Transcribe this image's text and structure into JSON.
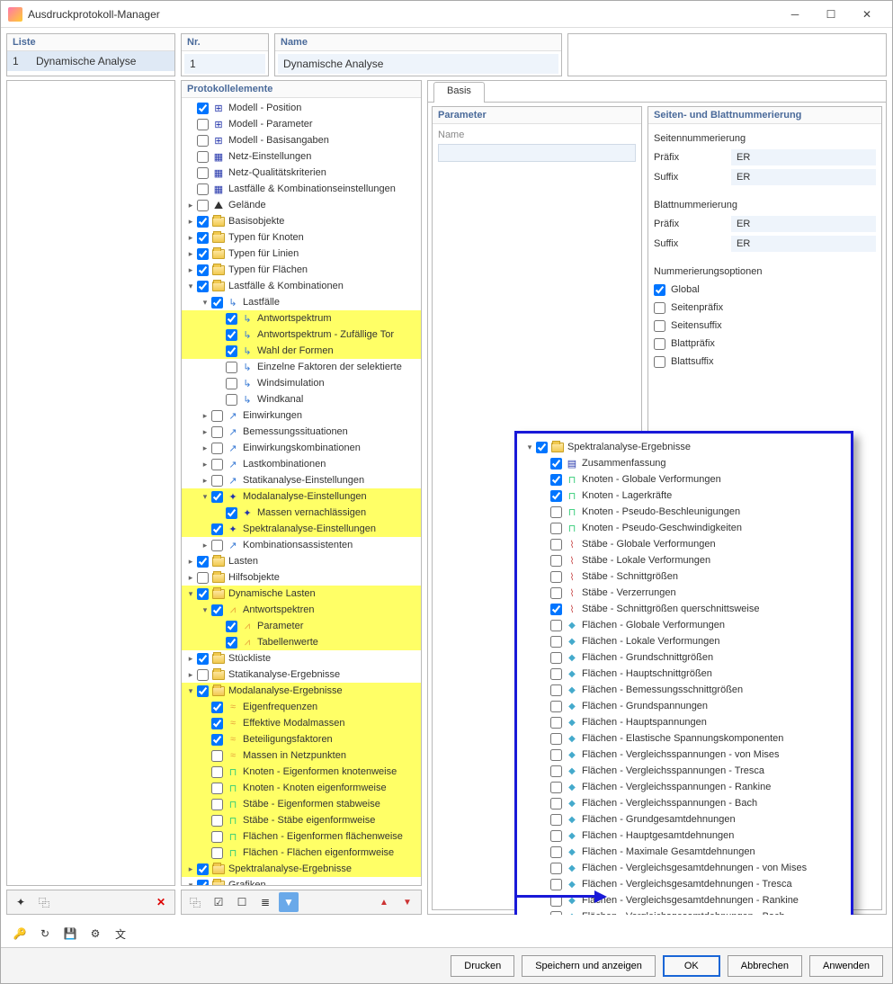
{
  "window": {
    "title": "Ausdruckprotokoll-Manager"
  },
  "liste": {
    "header": "Liste",
    "num": "1",
    "name": "Dynamische Analyse"
  },
  "nr": {
    "header": "Nr.",
    "value": "1"
  },
  "name": {
    "header": "Name",
    "value": "Dynamische Analyse"
  },
  "proto": {
    "header": "Protokollelemente"
  },
  "tree": [
    {
      "d": 0,
      "c": null,
      "k": true,
      "i": "mod",
      "t": "Modell - Position"
    },
    {
      "d": 0,
      "c": null,
      "k": false,
      "i": "mod",
      "t": "Modell - Parameter"
    },
    {
      "d": 0,
      "c": null,
      "k": false,
      "i": "mod",
      "t": "Modell - Basisangaben"
    },
    {
      "d": 0,
      "c": null,
      "k": false,
      "i": "grid",
      "t": "Netz-Einstellungen"
    },
    {
      "d": 0,
      "c": null,
      "k": false,
      "i": "grid",
      "t": "Netz-Qualitätskriterien"
    },
    {
      "d": 0,
      "c": null,
      "k": false,
      "i": "grid",
      "t": "Lastfälle & Kombinationseinstellungen"
    },
    {
      "d": 0,
      "c": "r",
      "k": false,
      "i": "ter",
      "t": "Gelände"
    },
    {
      "d": 0,
      "c": "r",
      "k": true,
      "i": "fld",
      "t": "Basisobjekte"
    },
    {
      "d": 0,
      "c": "r",
      "k": true,
      "i": "fld",
      "t": "Typen für Knoten"
    },
    {
      "d": 0,
      "c": "r",
      "k": true,
      "i": "fld",
      "t": "Typen für Linien"
    },
    {
      "d": 0,
      "c": "r",
      "k": true,
      "i": "fld",
      "t": "Typen für Flächen"
    },
    {
      "d": 0,
      "c": "d",
      "k": true,
      "i": "fld",
      "t": "Lastfälle & Kombinationen"
    },
    {
      "d": 1,
      "c": "d",
      "k": true,
      "i": "blue",
      "t": "Lastfälle"
    },
    {
      "d": 2,
      "c": null,
      "k": true,
      "i": "blue",
      "t": "Antwortspektrum",
      "hl": true
    },
    {
      "d": 2,
      "c": null,
      "k": true,
      "i": "blue",
      "t": "Antwortspektrum - Zufällige Tor",
      "hl": true
    },
    {
      "d": 2,
      "c": null,
      "k": true,
      "i": "blue",
      "t": "Wahl der Formen",
      "hl": true
    },
    {
      "d": 2,
      "c": null,
      "k": false,
      "i": "blue",
      "t": "Einzelne Faktoren der selektierte"
    },
    {
      "d": 2,
      "c": null,
      "k": false,
      "i": "blue",
      "t": "Windsimulation"
    },
    {
      "d": 2,
      "c": null,
      "k": false,
      "i": "blue",
      "t": "Windkanal"
    },
    {
      "d": 1,
      "c": "r",
      "k": false,
      "i": "arr",
      "t": "Einwirkungen"
    },
    {
      "d": 1,
      "c": "r",
      "k": false,
      "i": "arr",
      "t": "Bemessungssituationen"
    },
    {
      "d": 1,
      "c": "r",
      "k": false,
      "i": "arr",
      "t": "Einwirkungskombinationen"
    },
    {
      "d": 1,
      "c": "r",
      "k": false,
      "i": "arr",
      "t": "Lastkombinationen"
    },
    {
      "d": 1,
      "c": "r",
      "k": false,
      "i": "arr",
      "t": "Statikanalyse-Einstellungen"
    },
    {
      "d": 1,
      "c": "d",
      "k": true,
      "i": "mod2",
      "t": "Modalanalyse-Einstellungen",
      "hl": true
    },
    {
      "d": 2,
      "c": null,
      "k": true,
      "i": "mod2",
      "t": "Massen vernachlässigen",
      "hl": true
    },
    {
      "d": 1,
      "c": null,
      "k": true,
      "i": "mod2",
      "t": "Spektralanalyse-Einstellungen",
      "hl": true
    },
    {
      "d": 1,
      "c": "r",
      "k": false,
      "i": "arr",
      "t": "Kombinationsassistenten"
    },
    {
      "d": 0,
      "c": "r",
      "k": true,
      "i": "fld",
      "t": "Lasten"
    },
    {
      "d": 0,
      "c": "r",
      "k": false,
      "i": "fld",
      "t": "Hilfsobjekte"
    },
    {
      "d": 0,
      "c": "d",
      "k": true,
      "i": "fld",
      "t": "Dynamische Lasten",
      "hl": true
    },
    {
      "d": 1,
      "c": "d",
      "k": true,
      "i": "spec",
      "t": "Antwortspektren",
      "hl": true
    },
    {
      "d": 2,
      "c": null,
      "k": true,
      "i": "spec",
      "t": "Parameter",
      "hl": true
    },
    {
      "d": 2,
      "c": null,
      "k": true,
      "i": "spec",
      "t": "Tabellenwerte",
      "hl": true
    },
    {
      "d": 0,
      "c": "r",
      "k": true,
      "i": "fld",
      "t": "Stückliste"
    },
    {
      "d": 0,
      "c": "r",
      "k": false,
      "i": "fld",
      "t": "Statikanalyse-Ergebnisse"
    },
    {
      "d": 0,
      "c": "d",
      "k": true,
      "i": "fld",
      "t": "Modalanalyse-Ergebnisse",
      "hl": true
    },
    {
      "d": 1,
      "c": null,
      "k": true,
      "i": "wave",
      "t": "Eigenfrequenzen",
      "hl": true
    },
    {
      "d": 1,
      "c": null,
      "k": true,
      "i": "wave",
      "t": "Effektive Modalmassen",
      "hl": true
    },
    {
      "d": 1,
      "c": null,
      "k": true,
      "i": "wave",
      "t": "Beteiligungsfaktoren",
      "hl": true
    },
    {
      "d": 1,
      "c": null,
      "k": false,
      "i": "wave",
      "t": "Massen in Netzpunkten",
      "hl": true
    },
    {
      "d": 1,
      "c": null,
      "k": false,
      "i": "node",
      "t": "Knoten - Eigenformen knotenweise",
      "hl": true
    },
    {
      "d": 1,
      "c": null,
      "k": false,
      "i": "node",
      "t": "Knoten - Knoten eigenformweise",
      "hl": true
    },
    {
      "d": 1,
      "c": null,
      "k": false,
      "i": "node",
      "t": "Stäbe - Eigenformen stabweise",
      "hl": true
    },
    {
      "d": 1,
      "c": null,
      "k": false,
      "i": "node",
      "t": "Stäbe - Stäbe eigenformweise",
      "hl": true
    },
    {
      "d": 1,
      "c": null,
      "k": false,
      "i": "node",
      "t": "Flächen - Eigenformen flächenweise",
      "hl": true
    },
    {
      "d": 1,
      "c": null,
      "k": false,
      "i": "node",
      "t": "Flächen - Flächen eigenformweise",
      "hl": true
    },
    {
      "d": 0,
      "c": "r",
      "k": true,
      "i": "fld",
      "t": "Spektralanalyse-Ergebnisse",
      "hl": true
    },
    {
      "d": 0,
      "c": "d",
      "k": true,
      "i": "fld",
      "t": "Grafiken"
    }
  ],
  "overlay": [
    {
      "d": 0,
      "c": "d",
      "k": true,
      "i": "fld",
      "t": "Spektralanalyse-Ergebnisse"
    },
    {
      "d": 1,
      "c": null,
      "k": true,
      "i": "sum",
      "t": "Zusammenfassung"
    },
    {
      "d": 1,
      "c": null,
      "k": true,
      "i": "node",
      "t": "Knoten - Globale Verformungen"
    },
    {
      "d": 1,
      "c": null,
      "k": true,
      "i": "node",
      "t": "Knoten - Lagerkräfte"
    },
    {
      "d": 1,
      "c": null,
      "k": false,
      "i": "node",
      "t": "Knoten - Pseudo-Beschleunigungen"
    },
    {
      "d": 1,
      "c": null,
      "k": false,
      "i": "node",
      "t": "Knoten - Pseudo-Geschwindigkeiten"
    },
    {
      "d": 1,
      "c": null,
      "k": false,
      "i": "sta",
      "t": "Stäbe - Globale Verformungen"
    },
    {
      "d": 1,
      "c": null,
      "k": false,
      "i": "sta",
      "t": "Stäbe - Lokale Verformungen"
    },
    {
      "d": 1,
      "c": null,
      "k": false,
      "i": "sta",
      "t": "Stäbe - Schnittgrößen"
    },
    {
      "d": 1,
      "c": null,
      "k": false,
      "i": "sta",
      "t": "Stäbe - Verzerrungen"
    },
    {
      "d": 1,
      "c": null,
      "k": true,
      "i": "sta",
      "t": "Stäbe - Schnittgrößen querschnittsweise"
    },
    {
      "d": 1,
      "c": null,
      "k": false,
      "i": "sur",
      "t": "Flächen - Globale Verformungen"
    },
    {
      "d": 1,
      "c": null,
      "k": false,
      "i": "sur",
      "t": "Flächen - Lokale Verformungen"
    },
    {
      "d": 1,
      "c": null,
      "k": false,
      "i": "sur",
      "t": "Flächen - Grundschnittgrößen"
    },
    {
      "d": 1,
      "c": null,
      "k": false,
      "i": "sur",
      "t": "Flächen - Hauptschnittgrößen"
    },
    {
      "d": 1,
      "c": null,
      "k": false,
      "i": "sur",
      "t": "Flächen - Bemessungsschnittgrößen"
    },
    {
      "d": 1,
      "c": null,
      "k": false,
      "i": "sur",
      "t": "Flächen - Grundspannungen"
    },
    {
      "d": 1,
      "c": null,
      "k": false,
      "i": "sur",
      "t": "Flächen - Hauptspannungen"
    },
    {
      "d": 1,
      "c": null,
      "k": false,
      "i": "sur",
      "t": "Flächen - Elastische Spannungskomponenten"
    },
    {
      "d": 1,
      "c": null,
      "k": false,
      "i": "sur",
      "t": "Flächen - Vergleichsspannungen - von Mises"
    },
    {
      "d": 1,
      "c": null,
      "k": false,
      "i": "sur",
      "t": "Flächen - Vergleichsspannungen - Tresca"
    },
    {
      "d": 1,
      "c": null,
      "k": false,
      "i": "sur",
      "t": "Flächen - Vergleichsspannungen - Rankine"
    },
    {
      "d": 1,
      "c": null,
      "k": false,
      "i": "sur",
      "t": "Flächen - Vergleichsspannungen - Bach"
    },
    {
      "d": 1,
      "c": null,
      "k": false,
      "i": "sur",
      "t": "Flächen - Grundgesamtdehnungen"
    },
    {
      "d": 1,
      "c": null,
      "k": false,
      "i": "sur",
      "t": "Flächen - Hauptgesamtdehnungen"
    },
    {
      "d": 1,
      "c": null,
      "k": false,
      "i": "sur",
      "t": "Flächen - Maximale Gesamtdehnungen"
    },
    {
      "d": 1,
      "c": null,
      "k": false,
      "i": "sur",
      "t": "Flächen - Vergleichsgesamtdehnungen - von Mises"
    },
    {
      "d": 1,
      "c": null,
      "k": false,
      "i": "sur",
      "t": "Flächen - Vergleichsgesamtdehnungen - Tresca"
    },
    {
      "d": 1,
      "c": null,
      "k": false,
      "i": "sur",
      "t": "Flächen - Vergleichsgesamtdehnungen - Rankine"
    },
    {
      "d": 1,
      "c": null,
      "k": false,
      "i": "sur",
      "t": "Flächen - Vergleichsgesamtdehnungen - Bach"
    }
  ],
  "tab": {
    "basis": "Basis"
  },
  "param": {
    "header": "Parameter",
    "name_label": "Name"
  },
  "numbering": {
    "header": "Seiten- und Blattnummerierung",
    "page_section": "Seitennummerierung",
    "prefix_label": "Präfix",
    "suffix_label": "Suffix",
    "prefix_val": "ER",
    "suffix_val": "ER",
    "sheet_section": "Blattnummerierung",
    "sheet_prefix_val": "ER",
    "sheet_suffix_val": "ER",
    "options_section": "Nummerierungsoptionen",
    "opts": [
      {
        "k": true,
        "t": "Global"
      },
      {
        "k": false,
        "t": "Seitenpräfix"
      },
      {
        "k": false,
        "t": "Seitensuffix"
      },
      {
        "k": false,
        "t": "Blattpräfix"
      },
      {
        "k": false,
        "t": "Blattsuffix"
      }
    ]
  },
  "buttons": {
    "print": "Drucken",
    "save_show": "Speichern und anzeigen",
    "ok": "OK",
    "cancel": "Abbrechen",
    "apply": "Anwenden"
  }
}
